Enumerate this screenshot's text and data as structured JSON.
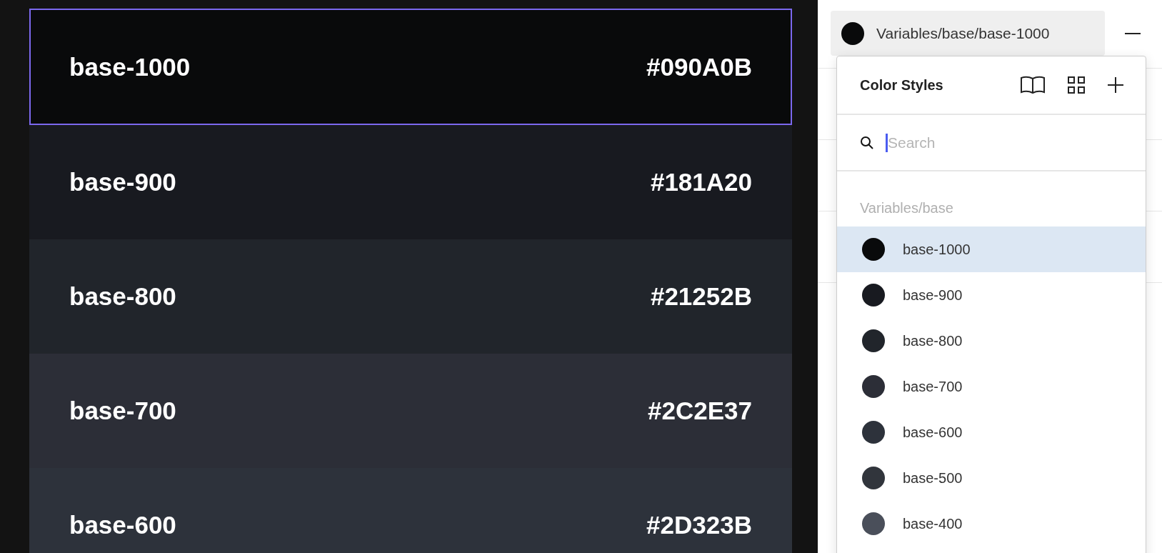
{
  "swatches": [
    {
      "name": "base-1000",
      "hex": "#090A0B",
      "color": "#090a0b",
      "selected": true
    },
    {
      "name": "base-900",
      "hex": "#181A20",
      "color": "#181a20",
      "selected": false
    },
    {
      "name": "base-800",
      "hex": "#21252B",
      "color": "#21252b",
      "selected": false
    },
    {
      "name": "base-700",
      "hex": "#2C2E37",
      "color": "#2c2e37",
      "selected": false
    },
    {
      "name": "base-600",
      "hex": "#2D323B",
      "color": "#2d323b",
      "selected": false
    }
  ],
  "fill": {
    "value": "Variables/base/base-1000",
    "color": "#090a0b"
  },
  "popup": {
    "title": "Color Styles",
    "search": {
      "placeholder": "Search"
    },
    "group": "Variables/base",
    "styles": [
      {
        "name": "base-1000",
        "color": "#090a0b",
        "selected": true
      },
      {
        "name": "base-900",
        "color": "#181a20",
        "selected": false
      },
      {
        "name": "base-800",
        "color": "#21252b",
        "selected": false
      },
      {
        "name": "base-700",
        "color": "#2c2e37",
        "selected": false
      },
      {
        "name": "base-600",
        "color": "#2d323b",
        "selected": false
      },
      {
        "name": "base-500",
        "color": "#31353c",
        "selected": false
      },
      {
        "name": "base-400",
        "color": "#4a4f5a",
        "selected": false
      }
    ]
  }
}
